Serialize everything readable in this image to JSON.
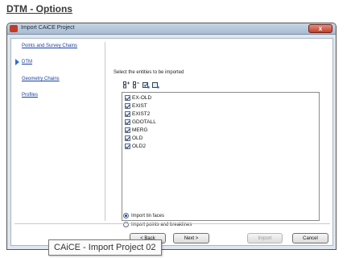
{
  "heading": "DTM - Options",
  "window": {
    "title": "Import CAiCE Project",
    "close_label": "x"
  },
  "nav": {
    "items": [
      {
        "label": "Points and Survey Chains"
      },
      {
        "label": "DTM"
      },
      {
        "label": "Geometry Chains"
      },
      {
        "label": "Profiles"
      }
    ],
    "active_index": 1
  },
  "main": {
    "instruction": "Select the entities to be imported",
    "toolbar_icons": [
      "select-all-icon",
      "deselect-all-icon",
      "check-selected-icon",
      "uncheck-selected-icon"
    ],
    "entities": [
      {
        "label": "EX-OLD",
        "checked": true
      },
      {
        "label": "EXIST",
        "checked": true
      },
      {
        "label": "EXIST2",
        "checked": true
      },
      {
        "label": "GDOTALL",
        "checked": true
      },
      {
        "label": "MERG",
        "checked": true
      },
      {
        "label": "OLD",
        "checked": true
      },
      {
        "label": "OLD2",
        "checked": true
      }
    ],
    "options": [
      {
        "label": "Import tin faces",
        "selected": true
      },
      {
        "label": "Import points and breaklines",
        "selected": false
      }
    ]
  },
  "buttons": {
    "back": "< Back",
    "next": "Next >",
    "import": "Import",
    "cancel": "Cancel"
  },
  "tooltip": "CAiCE - Import Project 02",
  "colors": {
    "link": "#1a3fa0",
    "titlebar": "#b6c6da",
    "active_arrow": "#2f6fd0"
  }
}
